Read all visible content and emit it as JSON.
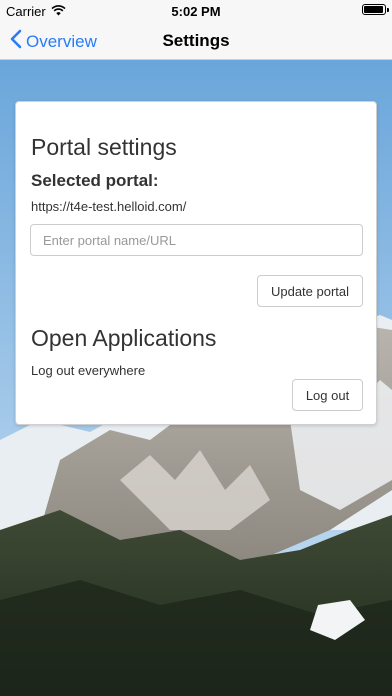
{
  "status_bar": {
    "carrier": "Carrier",
    "time": "5:02 PM",
    "wifi_icon": "wifi-icon",
    "battery_icon": "battery-icon"
  },
  "nav": {
    "back_label": "Overview",
    "back_icon": "chevron-left-icon",
    "title": "Settings",
    "accent_color": "#2a7bf6"
  },
  "portal": {
    "heading": "Portal settings",
    "selected_label": "Selected portal:",
    "selected_url": "https://t4e-test.helloid.com/",
    "input_value": "",
    "input_placeholder": "Enter portal name/URL",
    "update_button": "Update portal"
  },
  "open_apps": {
    "heading": "Open Applications",
    "description": "Log out everywhere",
    "logout_button": "Log out"
  }
}
